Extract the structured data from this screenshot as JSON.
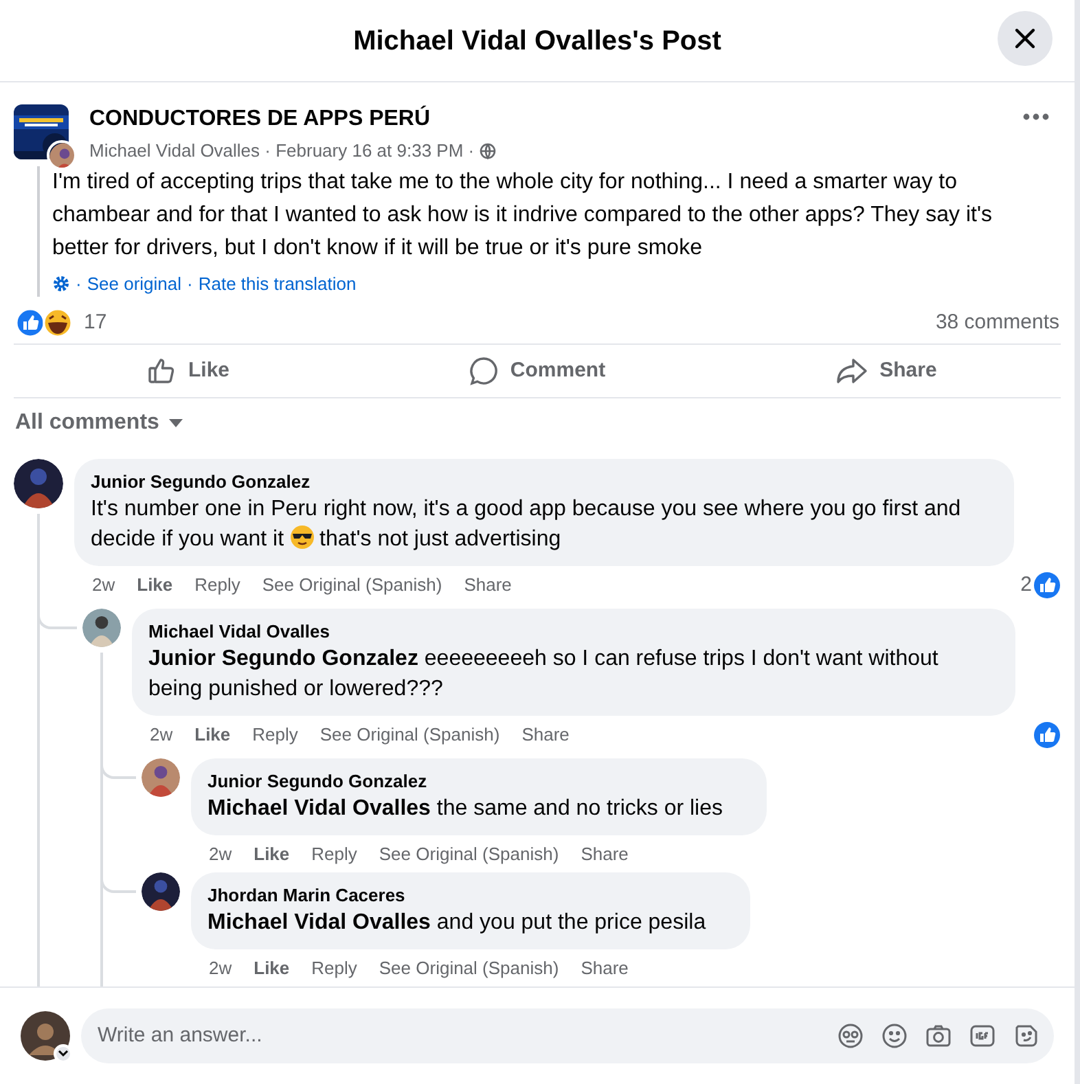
{
  "dialog": {
    "title": "Michael Vidal Ovalles's Post"
  },
  "post": {
    "group": "CONDUCTORES DE APPS PERÚ",
    "meta": "Michael Vidal Ovalles · February 16 at 9:33 PM ·",
    "text": "I'm tired of accepting trips that take me to the whole city for nothing... I need a smarter way to chambear and for that I wanted to ask how is it indrive compared to the other apps? They say it's better for drivers, but I don't know if it will be true or it's pure smoke",
    "separator": "·",
    "translation_links": [
      "See original",
      "Rate this translation"
    ],
    "reaction_count": "17",
    "comment_count": "38 comments"
  },
  "actions": [
    {
      "kind": "like",
      "label": "Like"
    },
    {
      "kind": "comment",
      "label": "Comment"
    },
    {
      "kind": "share",
      "label": "Share"
    }
  ],
  "comments_filter": "All comments",
  "comments": [
    {
      "author": "Junior Segundo Gonzalez",
      "text": "It's number one in Peru right now, it's a good app because you see where you go first and decide if you want it",
      "text_after_emoji": "that's not just advertising",
      "time": "2w",
      "actions": [
        "Like",
        "Reply",
        "See Original (Spanish)",
        "Share"
      ],
      "liked": true,
      "like_count": "2",
      "children": [
        {
          "author": "Michael Vidal Ovalles",
          "text": "**Junior Segundo Gonzalez** eeeeeeeeeh so I can refuse trips I don't want without being punished or lowered???",
          "time": "2w",
          "actions": [
            "Like",
            "Reply",
            "See Original (Spanish)",
            "Share"
          ],
          "liked": true,
          "children": [
            {
              "author": "Junior Segundo Gonzalez",
              "text": "**Michael Vidal Ovalles** the same and no tricks or lies",
              "time": "2w",
              "actions": [
                "Like",
                "Reply",
                "See Original (Spanish)",
                "Share"
              ],
              "liked": false
            },
            {
              "author": "Jhordan Marin Caceres",
              "text": "**Michael Vidal Ovalles** and you put the price pesila",
              "time": "2w",
              "actions": [
                "Like",
                "Reply",
                "See Original (Spanish)",
                "Share"
              ],
              "liked": false
            }
          ]
        }
      ]
    }
  ],
  "composer": {
    "placeholder": "Write an answer..."
  }
}
